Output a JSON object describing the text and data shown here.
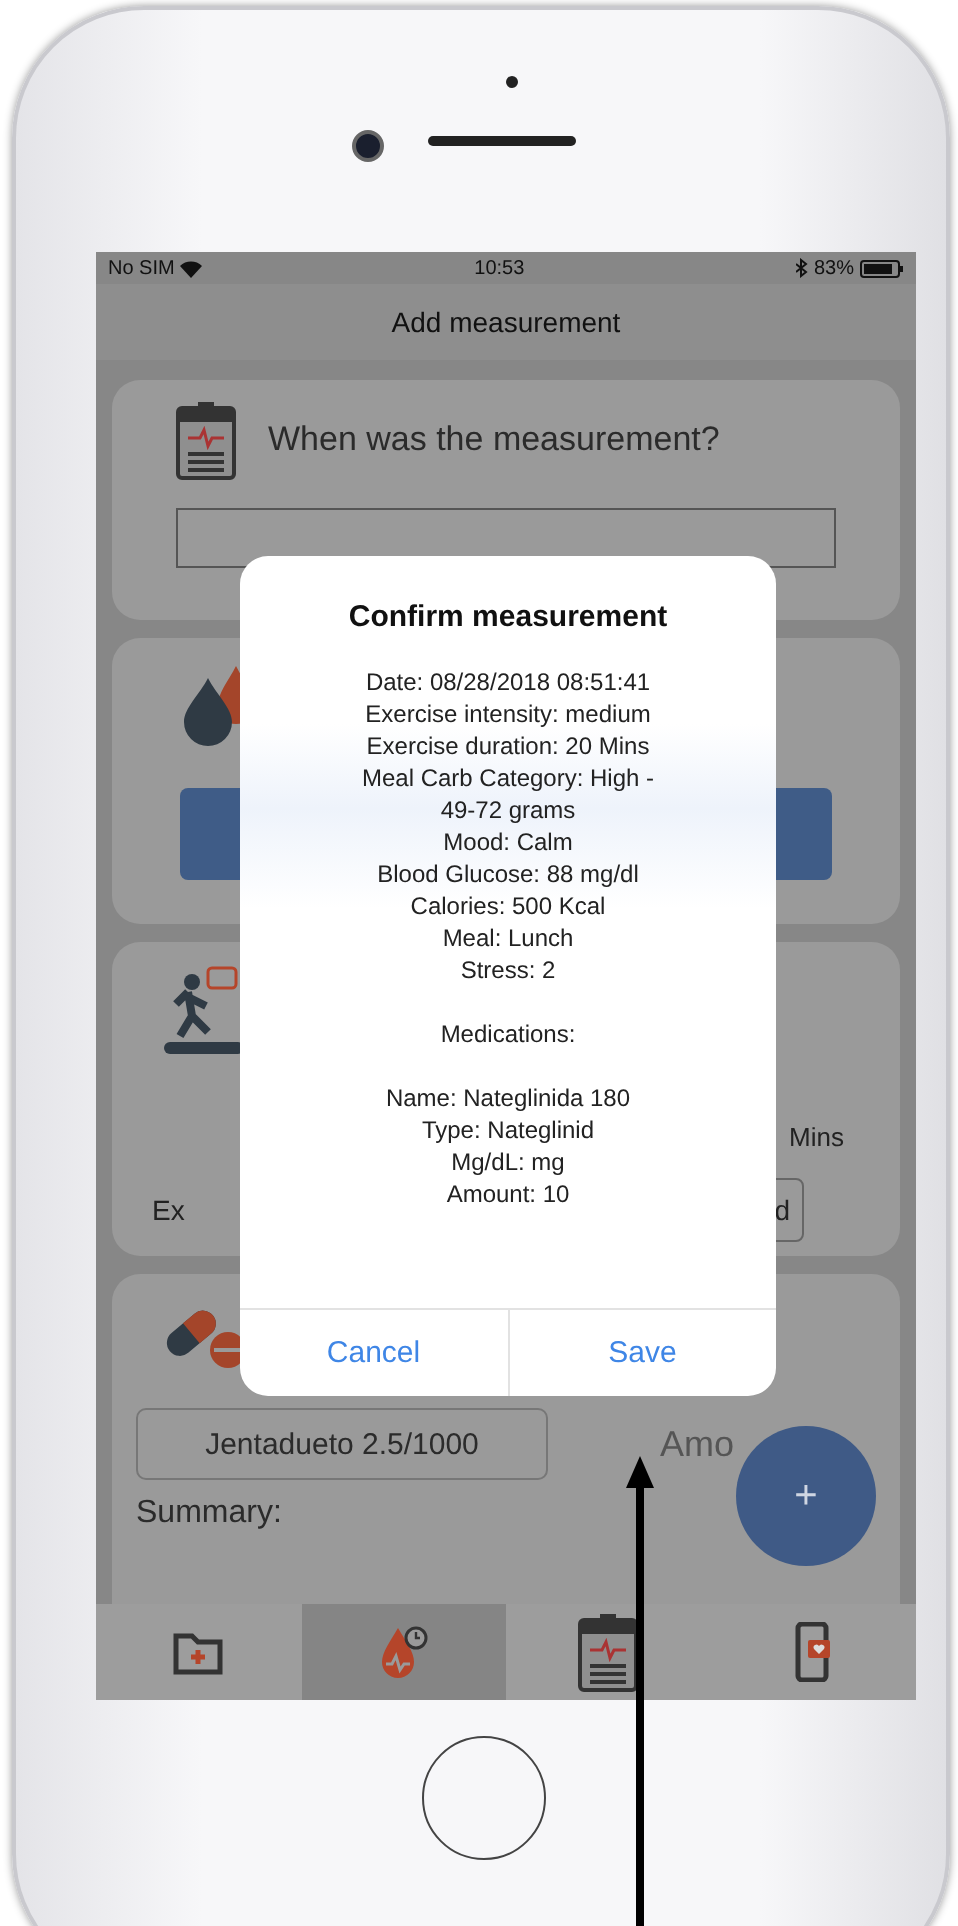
{
  "status_bar": {
    "carrier": "No SIM",
    "time": "10:53",
    "battery": "83%"
  },
  "nav_title": "Add measurement",
  "date_card": {
    "question": "When was the measurement?"
  },
  "exercise_card": {
    "duration_unit": "Mins",
    "intensity_label": "Ex",
    "intensity_value": "d"
  },
  "medication_card": {
    "medication": "Jentadueto 2.5/1000",
    "amount_label": "Amo",
    "summary_label": "Summary:"
  },
  "fab": {
    "label": "+"
  },
  "tabs": [
    {
      "kind": "folder",
      "selected": false
    },
    {
      "kind": "drop",
      "selected": true
    },
    {
      "kind": "clipboard",
      "selected": false
    },
    {
      "kind": "phone",
      "selected": false
    }
  ],
  "alert": {
    "title": "Confirm measurement",
    "details": [
      "Date: 08/28/2018 08:51:41",
      "Exercise intensity: medium",
      "Exercise duration: 20 Mins",
      "Meal Carb Category: High - 49-72 grams",
      "Mood: Calm",
      "Blood Glucose: 88 mg/dl",
      "Calories: 500 Kcal",
      "Meal: Lunch",
      "Stress: 2"
    ],
    "medications_heading": "Medications:",
    "medication_details": [
      "Name: Nateglinida 180",
      "Type: Nateglinid",
      "Mg/dL: mg",
      "Amount: 10"
    ],
    "buttons": [
      "Cancel",
      "Save"
    ]
  }
}
